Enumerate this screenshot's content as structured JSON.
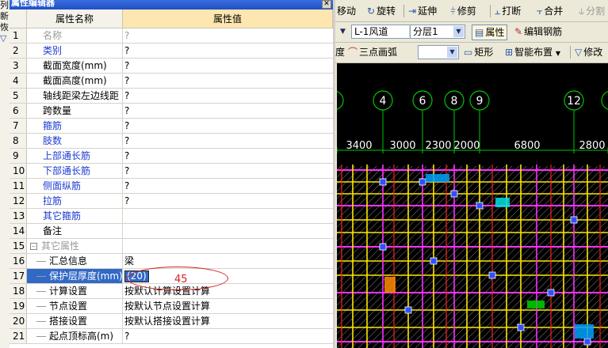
{
  "left_edge": {
    "chars": [
      "列",
      "新",
      "恢",
      "▽"
    ]
  },
  "property_editor": {
    "title": "属性编辑器",
    "close_glyph": "✕",
    "columns": {
      "num": "",
      "name": "属性名称",
      "value": "属性值"
    },
    "rows": [
      {
        "n": "1",
        "name": "名称",
        "value": "?",
        "style": "gray"
      },
      {
        "n": "2",
        "name": "类别",
        "value": "?",
        "style": "blue"
      },
      {
        "n": "3",
        "name": "截面宽度(mm)",
        "value": "?",
        "style": ""
      },
      {
        "n": "4",
        "name": "截面高度(mm)",
        "value": "?",
        "style": ""
      },
      {
        "n": "5",
        "name": "轴线距梁左边线距",
        "value": "?",
        "style": ""
      },
      {
        "n": "6",
        "name": "跨数量",
        "value": "?",
        "style": ""
      },
      {
        "n": "7",
        "name": "箍筋",
        "value": "?",
        "style": "blue"
      },
      {
        "n": "8",
        "name": "肢数",
        "value": "?",
        "style": "blue"
      },
      {
        "n": "9",
        "name": "上部通长筋",
        "value": "?",
        "style": "blue"
      },
      {
        "n": "10",
        "name": "下部通长筋",
        "value": "?",
        "style": "blue"
      },
      {
        "n": "11",
        "name": "侧面纵筋",
        "value": "?",
        "style": "blue"
      },
      {
        "n": "12",
        "name": "拉筋",
        "value": "?",
        "style": "blue"
      },
      {
        "n": "13",
        "name": "其它箍筋",
        "value": "",
        "style": "blue"
      },
      {
        "n": "14",
        "name": "备注",
        "value": "",
        "style": ""
      },
      {
        "n": "15",
        "name": "其它属性",
        "value": "",
        "style": "group"
      },
      {
        "n": "16",
        "name": "汇总信息",
        "value": "梁",
        "style": "tree"
      },
      {
        "n": "17",
        "name": "保护层厚度(mm)",
        "value": "(20)",
        "style": "tree-selected"
      },
      {
        "n": "18",
        "name": "计算设置",
        "value": "按默认计算设置计算",
        "style": "tree"
      },
      {
        "n": "19",
        "name": "节点设置",
        "value": "按默认节点设置计算",
        "style": "tree"
      },
      {
        "n": "20",
        "name": "搭接设置",
        "value": "按默认搭接设置计算",
        "style": "tree"
      },
      {
        "n": "21",
        "name": "起点顶标高(m)",
        "value": "?",
        "style": "tree"
      }
    ],
    "group_toggle": "−",
    "annotation": "45",
    "annotation_color": "#d22222"
  },
  "toolbar1": {
    "move": "移动",
    "rotate": "旋转",
    "extend": "延伸",
    "trim": "修剪",
    "break": "打断",
    "merge": "合并",
    "split": "分割"
  },
  "toolbar2": {
    "type_select": "L-1风道",
    "layer_select": "分层1",
    "properties": "属性",
    "edit_rebar": "编辑钢筋"
  },
  "toolbar3": {
    "cut_label": "度",
    "three_point_arc": "三点画弧",
    "empty_select": "",
    "rectangle": "矩形",
    "smart_layout": "智能布置",
    "modify": "修改"
  },
  "cad": {
    "axis_labels": [
      "4",
      "6",
      "8",
      "9",
      "12"
    ],
    "dimensions": [
      "3400",
      "3000",
      "2300",
      "2000",
      "6800",
      "2800"
    ],
    "colors": {
      "background": "#000000",
      "axis": "#00c800",
      "beam_yellow": "#ffe600",
      "beam_magenta": "#ff30ff",
      "beam_red": "#ff2020",
      "hatch": "#c8c8c8",
      "dim_text": "#ffffff"
    }
  }
}
